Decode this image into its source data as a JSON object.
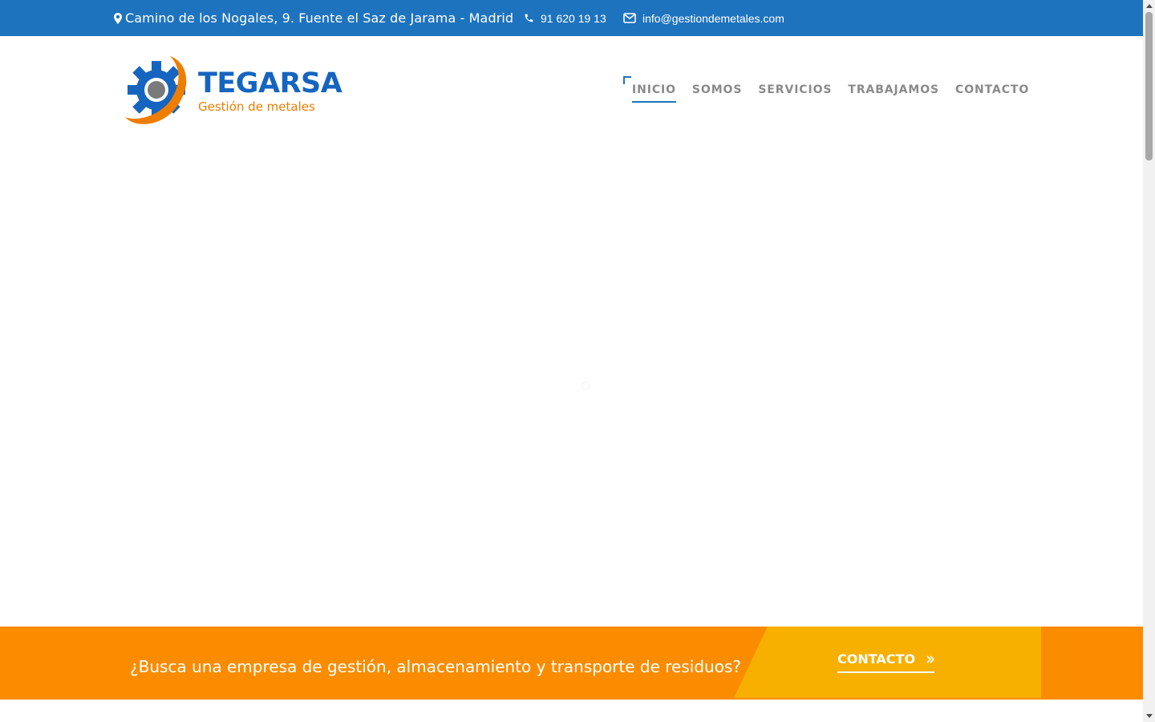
{
  "topbar": {
    "address": "Camino de los Nogales, 9. Fuente el Saz de Jarama - Madrid",
    "phone": "91 620 19 13",
    "email": "info@gestiondemetales.com",
    "bg_color": "#1e73be"
  },
  "logo": {
    "name": "TEGARSA",
    "tagline": "Gestión de metales"
  },
  "nav": {
    "items": [
      "INICIO",
      "SOMOS",
      "SERVICIOS",
      "TRABAJAMOS",
      "CONTACTO"
    ],
    "active": "INICIO"
  },
  "cta": {
    "question": "¿Busca una empresa de gestión, almacenamiento y transporte de residuos?",
    "button_label": "CONTACTO",
    "bg_color": "#fb8c00",
    "panel_color": "#f7b000"
  },
  "icons": {
    "address": "map-marker-icon",
    "phone": "phone-icon",
    "email": "envelope-icon",
    "cta_arrow": "double-chevron-right-icon"
  }
}
